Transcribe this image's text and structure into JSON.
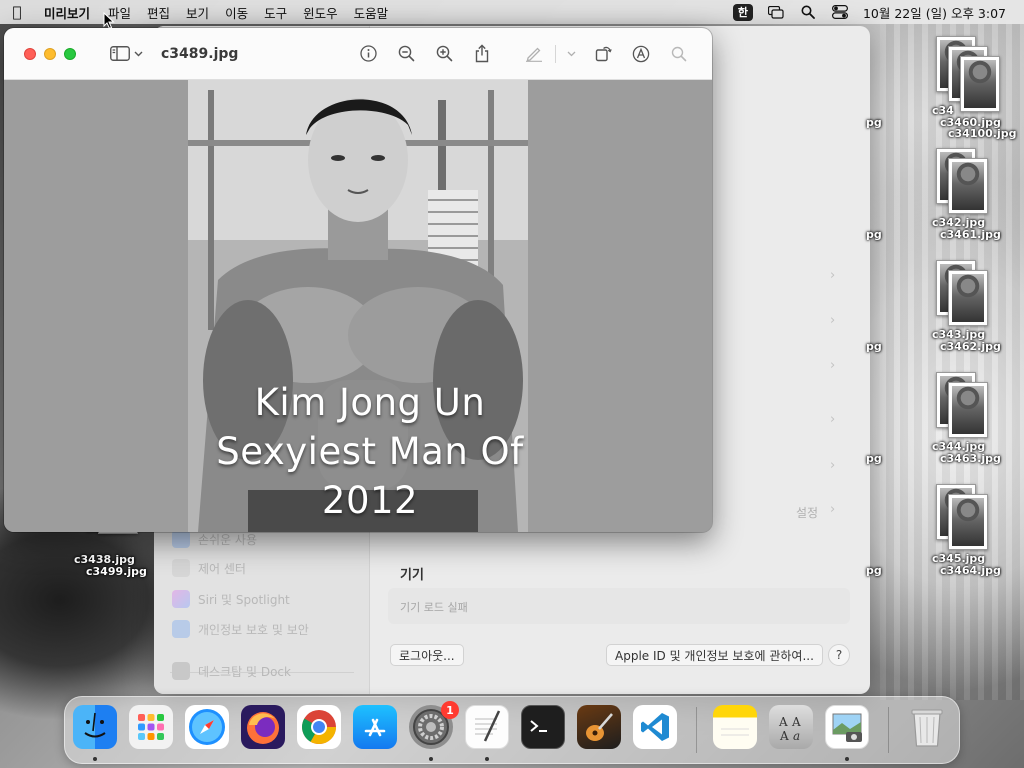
{
  "menubar": {
    "app_name": "미리보기",
    "menus": [
      "파일",
      "편집",
      "보기",
      "이동",
      "도구",
      "윈도우",
      "도움말"
    ],
    "input_source": "한",
    "clock": "10월 22일 (일) 오후 3:07"
  },
  "preview": {
    "title": "c3489.jpg",
    "caption_lines": [
      "Kim Jong Un",
      "Sexyiest Man Of",
      "2012"
    ]
  },
  "settings_window": {
    "sidebar_items": [
      "손쉬운 사용",
      "제어 센터",
      "Siri 및 Spotlight",
      "개인정보 보호 및 보안",
      "데스크탑 및 Dock"
    ],
    "settings_link": "설정",
    "devices_title": "기기",
    "devices_status": "기기 로드 실패",
    "logout_button": "로그아웃...",
    "about_button": "Apple ID 및 개인정보 보호에 관하여...",
    "help_button": "?"
  },
  "desktop_files": {
    "left_group": [
      "c3438.jpg",
      "c3499.jpg"
    ],
    "right_groups": [
      [
        "c34",
        "c3460.jpg",
        "c34100.jpg"
      ],
      [
        "c342.jpg",
        "c3461.jpg"
      ],
      [
        "c343.jpg",
        "c3462.jpg"
      ],
      [
        "c344.jpg",
        "c3463.jpg"
      ],
      [
        "c345.jpg",
        "c3464.jpg"
      ]
    ],
    "partial_labels": [
      "pg",
      "pg",
      "pg",
      "pg",
      "pg"
    ]
  },
  "dock": {
    "apps": [
      "Finder",
      "Launchpad",
      "Safari",
      "Firefox",
      "Chrome",
      "App Store",
      "System Settings",
      "TextEdit",
      "Terminal",
      "GarageBand",
      "Visual Studio Code",
      "Notes",
      "Font Book",
      "Preview",
      "Trash"
    ],
    "settings_badge": "1"
  },
  "colors": {
    "close": "#ff5f57",
    "minimize": "#febc2e",
    "maximize": "#28c840",
    "badge": "#ff3b30"
  }
}
